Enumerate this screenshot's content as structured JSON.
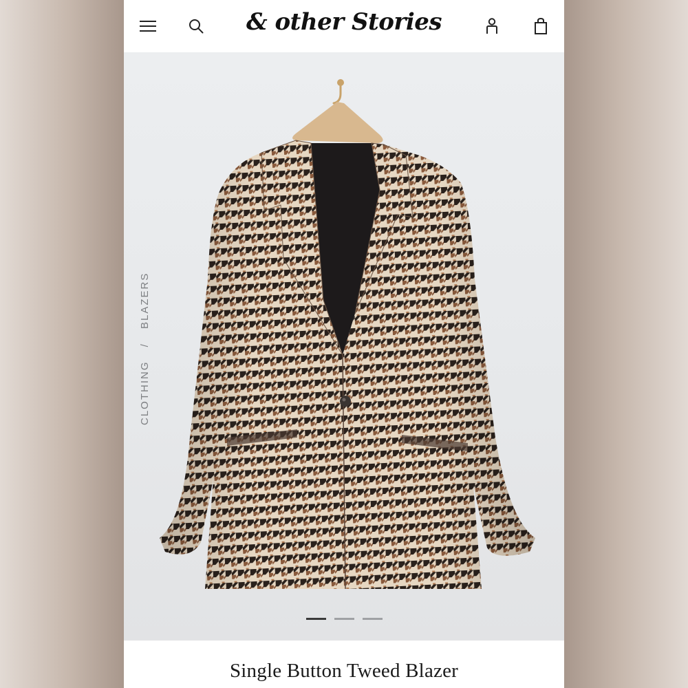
{
  "header": {
    "brand": "& other Stories",
    "icons": [
      "menu-icon",
      "search-icon",
      "account-icon",
      "bag-icon"
    ]
  },
  "breadcrumb": {
    "items": [
      "CLOTHING",
      "BLAZERS"
    ],
    "separator": "/"
  },
  "product": {
    "title": "Single Button Tweed Blazer",
    "image_alt": "Houndstooth single button blazer on hanger"
  },
  "carousel": {
    "total": 3,
    "active": 1
  },
  "colors": {
    "brand_text": "#111111",
    "houndstooth_light": "#e6d7c2",
    "houndstooth_dark": "#2a211c",
    "houndstooth_brown": "#8a5a3c",
    "lining": "#1d1a1b"
  }
}
